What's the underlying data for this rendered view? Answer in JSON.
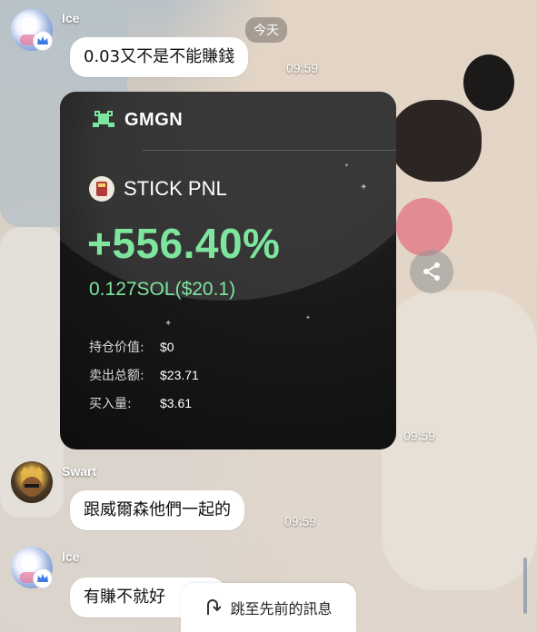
{
  "date_chip": "今天",
  "messages": [
    {
      "sender": "Ice",
      "text": "0.03又不是不能賺錢",
      "time": "09:59"
    },
    {
      "sender": "",
      "time": "09:59"
    },
    {
      "sender": "Swart",
      "text": "跟威爾森他們一起的",
      "time": "09:59"
    },
    {
      "sender": "Ice",
      "text": "有賺不就好"
    }
  ],
  "card": {
    "brand": "GMGN",
    "token": "STICK PNL",
    "pnl_percent": "+556.40%",
    "pnl_amount": "0.127SOL($20.1)",
    "stats": [
      {
        "label": "持仓价值:",
        "value": "$0"
      },
      {
        "label": "卖出总额:",
        "value": "$23.71"
      },
      {
        "label": "买入量:",
        "value": "$3.61"
      }
    ]
  },
  "jump_button": "跳至先前的訊息",
  "icons": {
    "share": "share-icon",
    "jump": "jump-up-icon",
    "brand_logo": "frog-logo-icon",
    "verified": "crown-badge-icon"
  },
  "colors": {
    "pnl_green": "#7ee59e",
    "card_bg": "#111111",
    "bubble_bg": "#ffffff"
  }
}
